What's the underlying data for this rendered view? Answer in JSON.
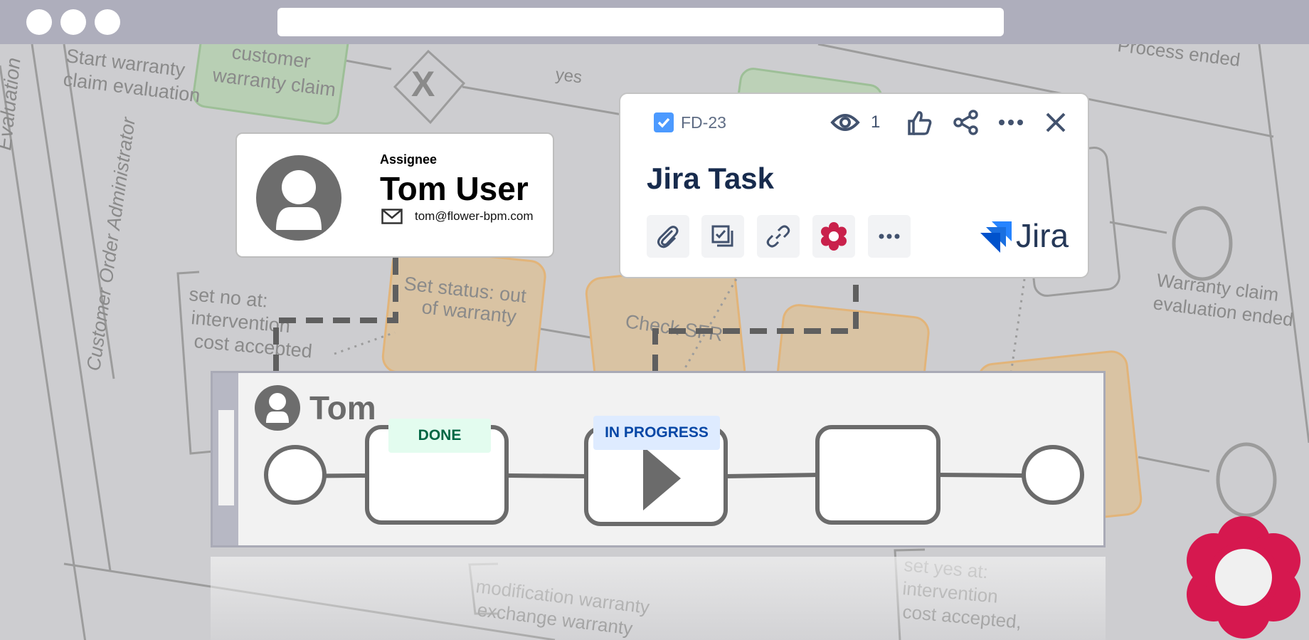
{
  "background_diagram": {
    "lanes": [
      "Evaluation",
      "Customer Order Administrator"
    ],
    "tasks": [
      "customer warranty claim",
      "Set status: out of warranty",
      "Check SFR ward"
    ],
    "events": [
      "Start warranty claim evaluation",
      "Process ended",
      "Warranty claim evaluation ended"
    ],
    "gateway_label": "yes",
    "annotations": [
      "set no at: intervention cost accepted",
      "modification warranty exchange warranty",
      "set yes at: intervention cost accepted, modif"
    ]
  },
  "assignee_card": {
    "label": "Assignee",
    "name": "Tom User",
    "email": "tom@flower-bpm.com",
    "mail_icon": "envelope-icon",
    "avatar_icon": "user-icon"
  },
  "jira_card": {
    "issue_key": "FD-23",
    "watchers": "1",
    "title": "Jira Task",
    "brand": "Jira",
    "colors": {
      "check": "#4c9aff",
      "brand": "#2684ff",
      "flower": "#c9214b",
      "title": "#172b4d"
    },
    "tools": [
      "paperclip-icon",
      "checklist-icon",
      "link-icon",
      "flower-icon",
      "more-icon"
    ]
  },
  "swimlane": {
    "owner": "Tom",
    "steps": [
      {
        "status": "DONE"
      },
      {
        "status": "IN PROGRESS"
      },
      {
        "status": ""
      }
    ]
  },
  "brand_colors": {
    "flower": "#d6184f",
    "done_bg": "#e3fcef",
    "done_fg": "#006644",
    "progress_bg": "#deebff",
    "progress_fg": "#0747a6"
  }
}
